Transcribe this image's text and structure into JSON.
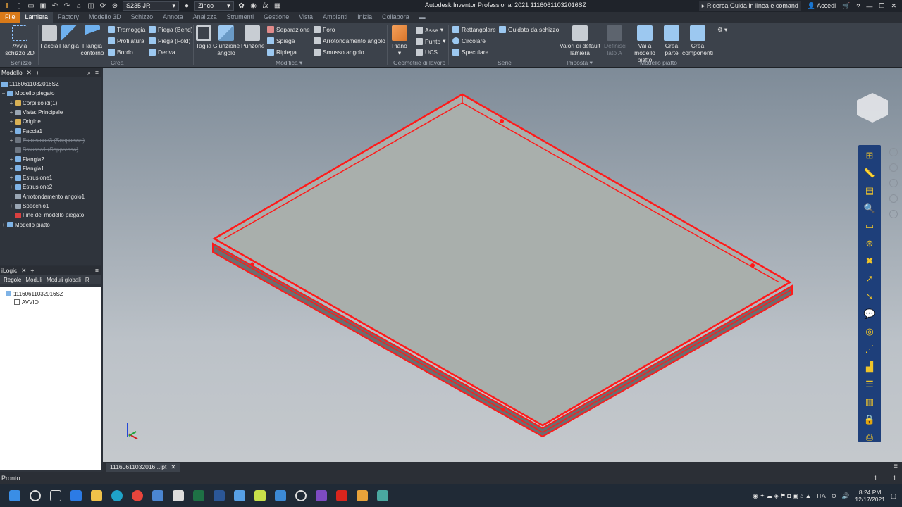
{
  "title_bar": {
    "material": "S235 JR",
    "appearance": "Zinco",
    "window_title": "Autodesk Inventor Professional 2021   11160611032016SZ",
    "search": "Ricerca Guida in linea e comand",
    "signin": "Accedi"
  },
  "tabs": [
    "File",
    "Lamiera",
    "Factory",
    "Modello 3D",
    "Schizzo",
    "Annota",
    "Analizza",
    "Strumenti",
    "Gestione",
    "Vista",
    "Ambienti",
    "Inizia",
    "Collabora"
  ],
  "ribbon": {
    "sketch": {
      "btn": "Avvia schizzo 2D",
      "label": "Schizzo"
    },
    "create": {
      "big": [
        "Faccia",
        "Flangia",
        "Flangia contorno"
      ],
      "small_col1": [
        "Tramoggia",
        "Profilatura",
        "Bordo"
      ],
      "small_col2": [
        "Piega (Bend)",
        "Piega (Fold)",
        "Deriva"
      ],
      "label": "Crea"
    },
    "modify": {
      "big": [
        "Taglia",
        "Giunzione angolo",
        "Punzone"
      ],
      "small_col1": [
        "Separazione",
        "Spiega",
        "Ripiega"
      ],
      "small_col2": [
        "Foro",
        "Arrotondamento angolo",
        "Smusso angolo"
      ],
      "label": "Modifica"
    },
    "work": {
      "big": "Piano",
      "small": [
        "Asse",
        "Punto",
        "UCS"
      ],
      "label": "Geometrie di lavoro"
    },
    "pattern": {
      "small": [
        "Rettangolare",
        "Circolare",
        "Speculare"
      ],
      "extra": "Guidata da schizzo",
      "label": "Serie"
    },
    "setup": {
      "big": "Valori di default lamiera",
      "label": "Imposta"
    },
    "flat": {
      "big": [
        "Definisci lato A",
        "Vai a modello piatto",
        "Crea parte",
        "Crea componenti"
      ],
      "label": "Modello piatto"
    }
  },
  "model_panel": {
    "tab": "Modello",
    "root": "11160611032016SZ",
    "nodes": [
      {
        "label": "Modello piegato",
        "indent": 0,
        "pm": "−",
        "suppressed": false
      },
      {
        "label": "Corpi solidi(1)",
        "indent": 1,
        "pm": "+",
        "suppressed": false
      },
      {
        "label": "Vista: Principale",
        "indent": 1,
        "pm": "+",
        "suppressed": false
      },
      {
        "label": "Origine",
        "indent": 1,
        "pm": "+",
        "suppressed": false
      },
      {
        "label": "Faccia1",
        "indent": 1,
        "pm": "+",
        "suppressed": false
      },
      {
        "label": "Estrusione3 (Soppresso)",
        "indent": 1,
        "pm": "+",
        "suppressed": true
      },
      {
        "label": "Smusso1 (Soppresso)",
        "indent": 1,
        "pm": "",
        "suppressed": true
      },
      {
        "label": "Flangia2",
        "indent": 1,
        "pm": "+",
        "suppressed": false
      },
      {
        "label": "Flangia1",
        "indent": 1,
        "pm": "+",
        "suppressed": false
      },
      {
        "label": "Estrusione1",
        "indent": 1,
        "pm": "+",
        "suppressed": false
      },
      {
        "label": "Estrusione2",
        "indent": 1,
        "pm": "+",
        "suppressed": false
      },
      {
        "label": "Arrotondamento angolo1",
        "indent": 1,
        "pm": "",
        "suppressed": false
      },
      {
        "label": "Specchio1",
        "indent": 1,
        "pm": "+",
        "suppressed": false
      },
      {
        "label": "Fine del modello piegato",
        "indent": 1,
        "pm": "",
        "suppressed": false
      },
      {
        "label": "Modello piatto",
        "indent": 0,
        "pm": "+",
        "suppressed": false
      }
    ]
  },
  "logic_panel": {
    "tab": "iLogic",
    "subtabs": [
      "Regole",
      "Moduli",
      "Moduli globali",
      "R"
    ],
    "root": "11160611032016SZ",
    "rule": "AVVIO"
  },
  "document_tab": "11160611032016...ipt",
  "status": {
    "text": "Pronto",
    "count1": "1",
    "count2": "1"
  },
  "taskbar": {
    "lang": "ITA",
    "time": "8:24 PM",
    "date": "12/17/2021"
  }
}
